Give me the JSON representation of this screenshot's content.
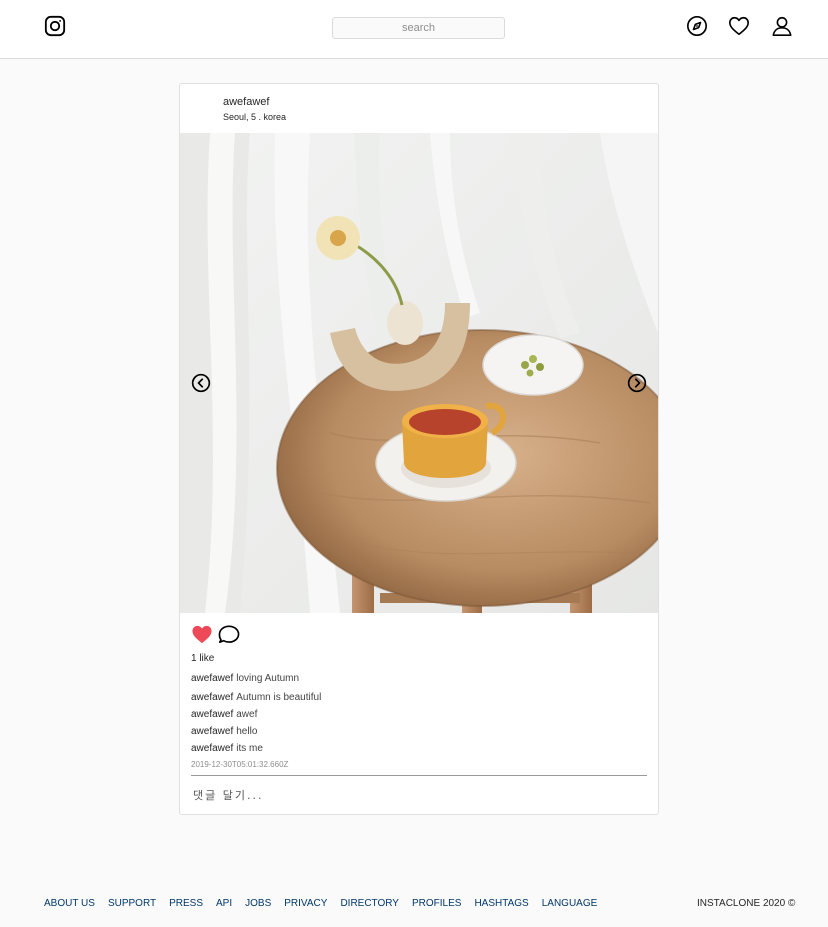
{
  "header": {
    "logo_icon": "instagram-logo-icon",
    "search_placeholder": "search",
    "nav_icons": [
      "compass-explore-icon",
      "heart-activity-icon",
      "user-profile-icon"
    ]
  },
  "post": {
    "author": "awefawef",
    "location": "Seoul, 5 . korea",
    "image_alt": "Autumn still life photo",
    "nav_prev_icon": "chevron-left-circle-icon",
    "nav_next_icon": "chevron-right-circle-icon",
    "liked": true,
    "like_color": "#ed4956",
    "likes_text": "1 like",
    "caption": {
      "user": "awefawef",
      "text": "loving Autumn"
    },
    "comments": [
      {
        "user": "awefawef",
        "text": "Autumn is beautiful"
      },
      {
        "user": "awefawef",
        "text": "awef"
      },
      {
        "user": "awefawef",
        "text": "hello"
      },
      {
        "user": "awefawef",
        "text": "its me"
      }
    ],
    "timestamp": "2019-12-30T05:01:32.660Z",
    "comment_placeholder": "댓글 달기..."
  },
  "footer": {
    "links": [
      "ABOUT US",
      "SUPPORT",
      "PRESS",
      "API",
      "JOBS",
      "PRIVACY",
      "DIRECTORY",
      "PROFILES",
      "HASHTAGS",
      "LANGUAGE"
    ],
    "copyright": "INSTACLONE 2020 ©",
    "link_color": "#00376b"
  }
}
